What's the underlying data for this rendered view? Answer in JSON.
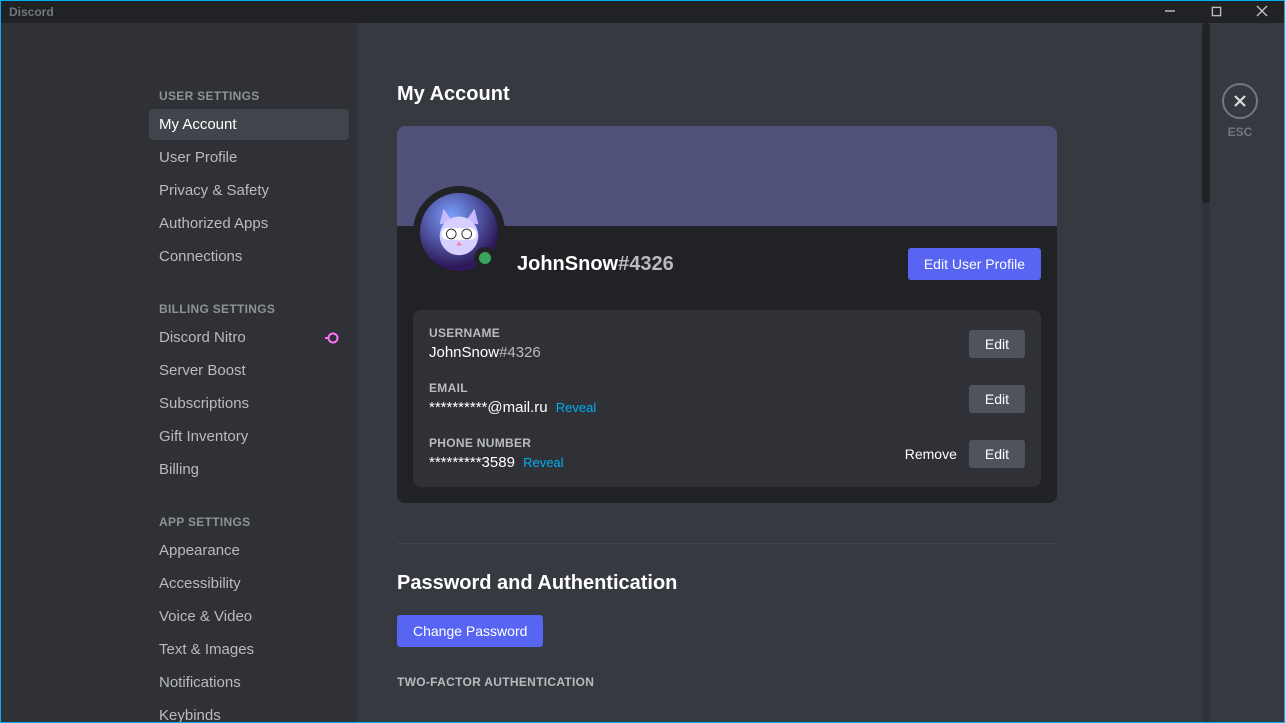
{
  "window": {
    "title": "Discord",
    "esc_label": "ESC"
  },
  "sidebar": {
    "groups": [
      {
        "header": "USER SETTINGS",
        "items": [
          {
            "label": "My Account",
            "active": true
          },
          {
            "label": "User Profile"
          },
          {
            "label": "Privacy & Safety"
          },
          {
            "label": "Authorized Apps"
          },
          {
            "label": "Connections"
          }
        ]
      },
      {
        "header": "BILLING SETTINGS",
        "items": [
          {
            "label": "Discord Nitro",
            "badge": "nitro"
          },
          {
            "label": "Server Boost"
          },
          {
            "label": "Subscriptions"
          },
          {
            "label": "Gift Inventory"
          },
          {
            "label": "Billing"
          }
        ]
      },
      {
        "header": "APP SETTINGS",
        "items": [
          {
            "label": "Appearance"
          },
          {
            "label": "Accessibility"
          },
          {
            "label": "Voice & Video"
          },
          {
            "label": "Text & Images"
          },
          {
            "label": "Notifications"
          },
          {
            "label": "Keybinds"
          }
        ]
      }
    ]
  },
  "page": {
    "title": "My Account",
    "edit_profile_btn": "Edit User Profile",
    "username": "JohnSnow",
    "discriminator": "#4326",
    "fields": {
      "username_label": "USERNAME",
      "username_value": "JohnSnow",
      "username_discrim": "#4326",
      "email_label": "EMAIL",
      "email_value": "**********@mail.ru",
      "email_reveal": "Reveal",
      "phone_label": "PHONE NUMBER",
      "phone_value": "*********3589",
      "phone_reveal": "Reveal"
    },
    "edit_btn": "Edit",
    "remove_btn": "Remove",
    "pw_section_title": "Password and Authentication",
    "change_pw_btn": "Change Password",
    "twofa_header": "TWO-FACTOR AUTHENTICATION"
  }
}
